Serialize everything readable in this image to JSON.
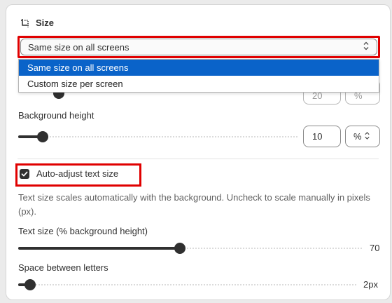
{
  "section": {
    "title": "Size",
    "icon": "resize-icon"
  },
  "size_mode": {
    "selected": "Same size on all screens",
    "options": [
      "Same size on all screens",
      "Custom size per screen"
    ]
  },
  "hidden_row": {
    "value": "20",
    "unit": "%"
  },
  "background_height": {
    "label": "Background height",
    "value": "10",
    "unit": "%",
    "slider_fraction": 0.0875
  },
  "auto_adjust": {
    "label": "Auto-adjust text size",
    "checked": true,
    "help": "Text size scales automatically with the background. Uncheck to scale manually in pixels (px)."
  },
  "text_size": {
    "label": "Text size (% background height)",
    "value": "70",
    "slider_fraction": 0.47
  },
  "letter_spacing": {
    "label": "Space between letters",
    "value": "2px",
    "slider_fraction": 0.035
  },
  "colors": {
    "highlight": "#e00000",
    "selected_option": "#0a63c9",
    "control": "#303030"
  }
}
